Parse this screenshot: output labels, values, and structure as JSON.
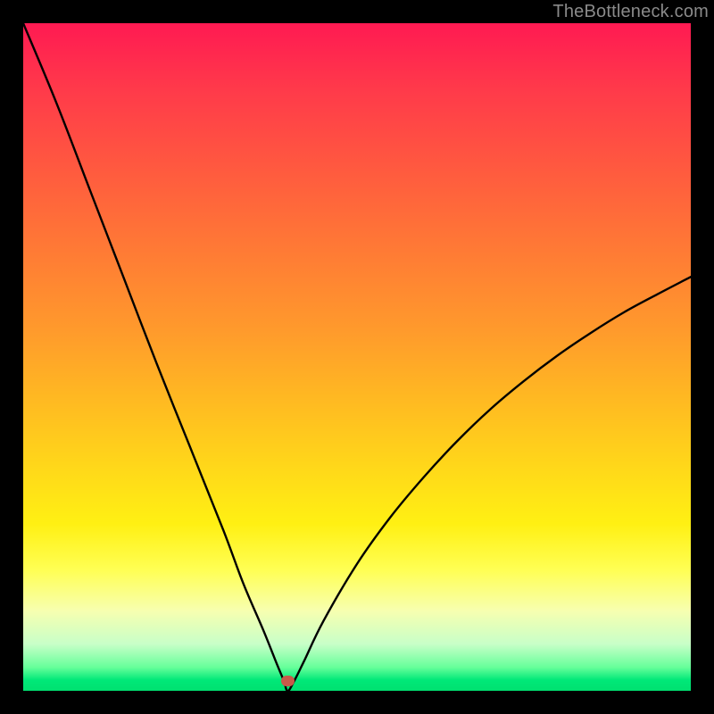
{
  "watermark": "TheBottleneck.com",
  "marker": {
    "x_frac": 0.396,
    "y_frac": 0.985,
    "color": "#c85a4a"
  },
  "chart_data": {
    "type": "line",
    "title": "",
    "xlabel": "",
    "ylabel": "",
    "xlim": [
      0,
      100
    ],
    "ylim": [
      0,
      100
    ],
    "grid": false,
    "series": [
      {
        "name": "bottleneck-curve",
        "x": [
          0,
          5,
          10,
          15,
          20,
          25,
          30,
          33,
          36,
          38,
          39,
          39.6,
          40.5,
          42,
          45,
          50,
          55,
          60,
          65,
          70,
          75,
          80,
          85,
          90,
          95,
          100
        ],
        "values": [
          100,
          88,
          75,
          62,
          49,
          36.5,
          24,
          16,
          9,
          4,
          1.6,
          0.0,
          1.3,
          4.3,
          10.5,
          19,
          26,
          32,
          37.4,
          42.2,
          46.4,
          50.2,
          53.6,
          56.7,
          59.4,
          62
        ]
      }
    ],
    "annotations": [
      {
        "type": "marker",
        "x": 39.6,
        "y": 1.0,
        "color": "#c85a4a"
      }
    ],
    "gradient_stops": [
      {
        "pct": 0,
        "color": "#ff1a52"
      },
      {
        "pct": 10,
        "color": "#ff3a4a"
      },
      {
        "pct": 22,
        "color": "#ff5a3f"
      },
      {
        "pct": 34,
        "color": "#ff7a35"
      },
      {
        "pct": 46,
        "color": "#ff9a2c"
      },
      {
        "pct": 56,
        "color": "#ffb822"
      },
      {
        "pct": 66,
        "color": "#ffd61a"
      },
      {
        "pct": 75,
        "color": "#fff013"
      },
      {
        "pct": 82,
        "color": "#ffff55"
      },
      {
        "pct": 88,
        "color": "#f7ffb0"
      },
      {
        "pct": 93,
        "color": "#c8ffc8"
      },
      {
        "pct": 96.5,
        "color": "#66ff9a"
      },
      {
        "pct": 98.4,
        "color": "#00e878"
      },
      {
        "pct": 100,
        "color": "#00e070"
      }
    ]
  }
}
